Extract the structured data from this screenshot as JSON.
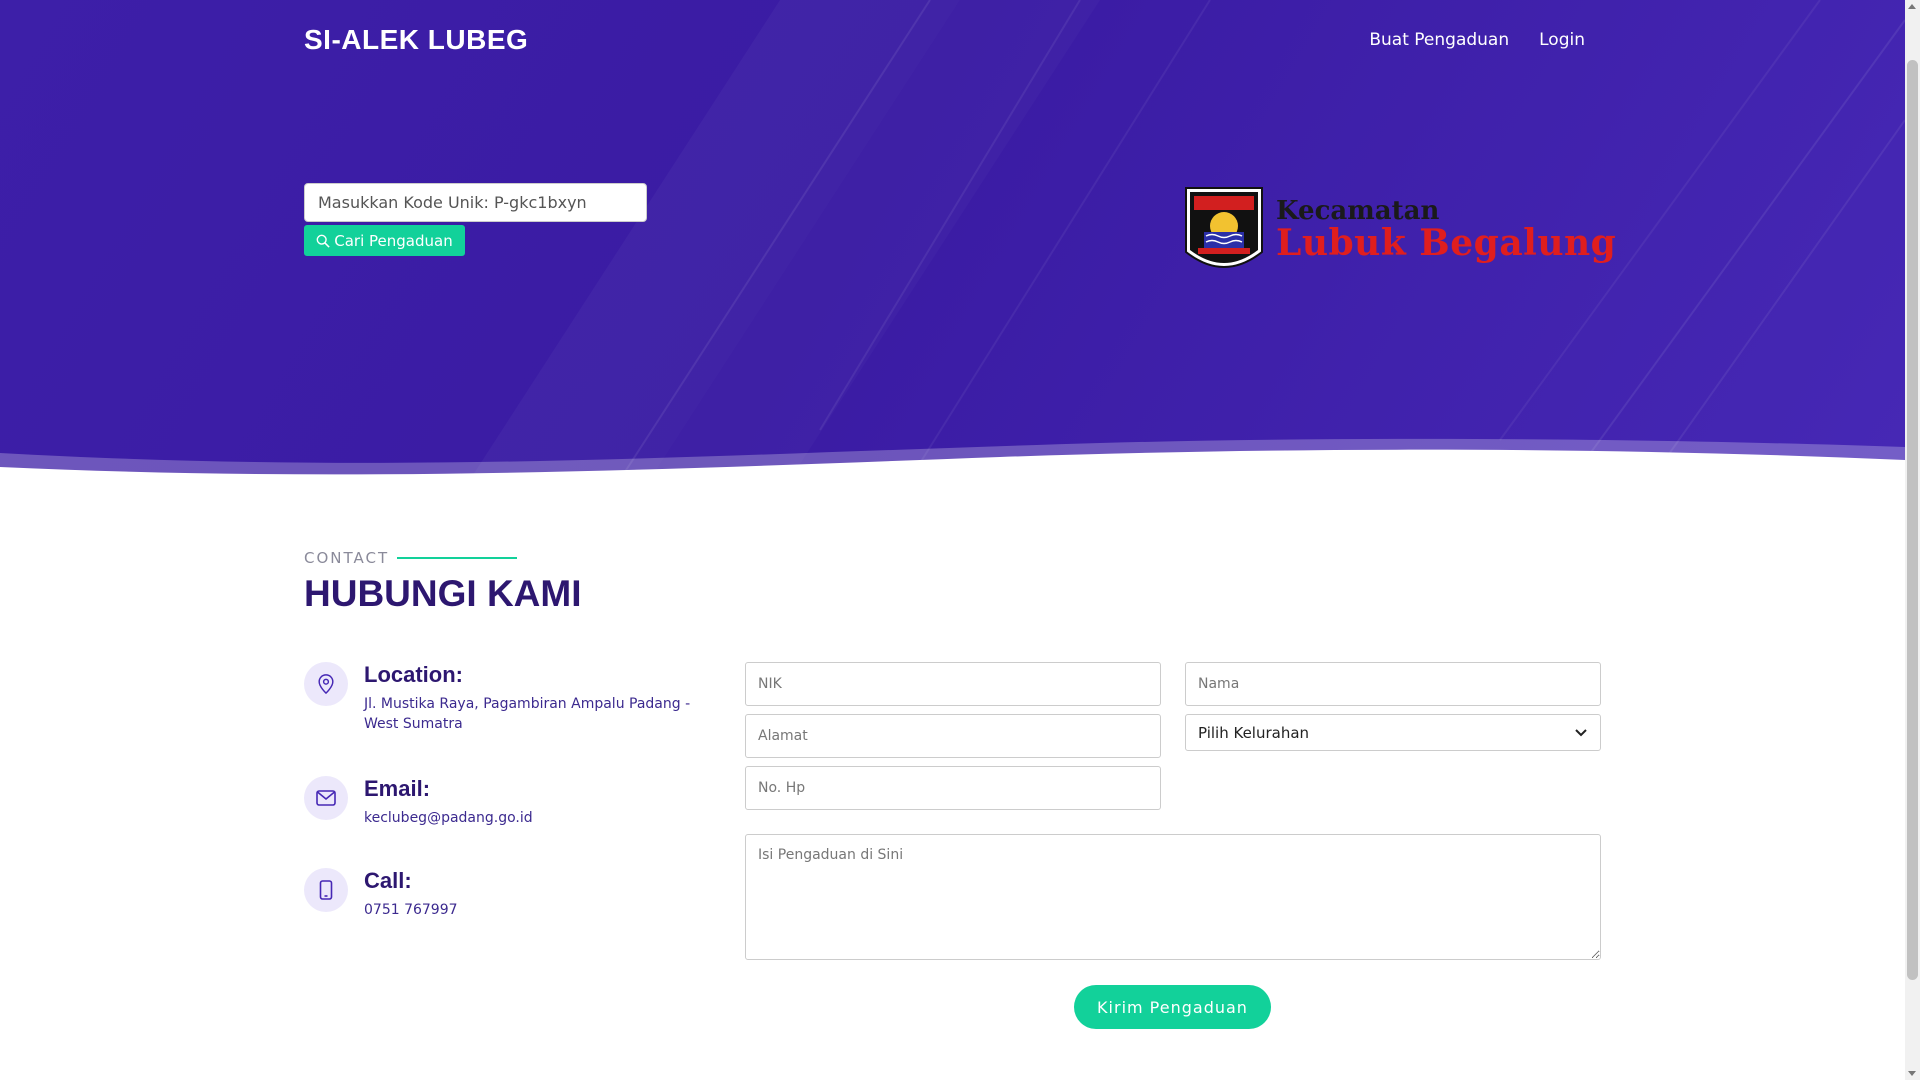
{
  "header": {
    "brand": "SI-ALEK LUBEG",
    "nav": [
      "Buat Pengaduan",
      "Login"
    ]
  },
  "hero": {
    "search_placeholder": "Masukkan Kode Unik: P-gkc1bxyn",
    "search_button": "Cari Pengaduan",
    "logo_line1": "Kecamatan",
    "logo_line2": "Lubuk Begalung"
  },
  "contact": {
    "label": "CONTACT",
    "title": "HUBUNGI KAMI",
    "location_title": "Location:",
    "location_value": "Jl. Mustika Raya, Pagambiran Ampalu Padang - West Sumatra",
    "email_title": "Email:",
    "email_value": "keclubeg@padang.go.id",
    "call_title": "Call:",
    "call_value": "0751 767997"
  },
  "form": {
    "nik_placeholder": "NIK",
    "nama_placeholder": "Nama",
    "alamat_placeholder": "Alamat",
    "kelurahan_selected": "Pilih Kelurahan",
    "hp_placeholder": "No. Hp",
    "isi_placeholder": "Isi Pengaduan di Sini",
    "submit_label": "Kirim Pengaduan"
  },
  "colors": {
    "hero": "#3a1ba3",
    "accent": "#12d19a",
    "heading": "#2d1770"
  }
}
